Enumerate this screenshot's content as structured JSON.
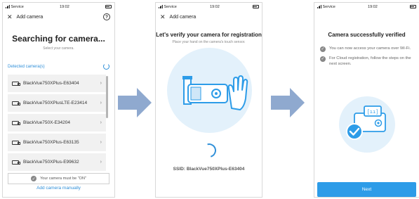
{
  "screens": [
    {
      "status": {
        "carrier": "Service",
        "time": "19:02"
      },
      "header": {
        "title": "Add camera",
        "help": "?"
      },
      "title": "Searching for camera...",
      "subtitle": "Select your camera.",
      "detected_label": "Detected camera(s)",
      "cameras": [
        "BlackVue750XPlus-E63404",
        "BlackVue750XPlusLTE-E23414",
        "BlackVue750X-E34204",
        "BlackVue750XPlus-E63135",
        "BlackVue750XPlus-E99632"
      ],
      "notice": "Your camera must be \"ON\"",
      "manual_link": "Add camera manually"
    },
    {
      "status": {
        "carrier": "Service",
        "time": "19:02"
      },
      "header": {
        "title": "Add camera"
      },
      "title": "Let's verify your camera for registration",
      "subtitle": "Place your hand on the camera's touch sensor.",
      "ssid": "SSID: BlackVue750XPlus-E63404"
    },
    {
      "status": {
        "carrier": "Service",
        "time": "19:02"
      },
      "title": "Camera successfully verified",
      "points": [
        "You can now access your camera over Wi-Fi.",
        "For Cloud registration, follow the steps on the next screen."
      ],
      "next_label": "Next"
    }
  ],
  "colors": {
    "accent": "#2f8fd8",
    "arrow": "#8fa9cf",
    "illustration_bg": "#e3f1fb"
  }
}
